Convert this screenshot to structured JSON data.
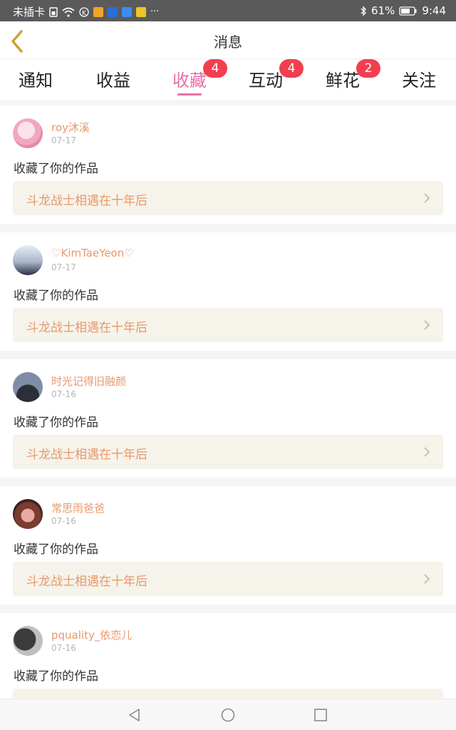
{
  "status": {
    "carrier": "未插卡",
    "more": "···",
    "battery": "61%",
    "time": "9:44"
  },
  "header": {
    "title": "消息",
    "back_icon": "chevron-left-icon"
  },
  "tabs": [
    {
      "label": "通知",
      "badge": ""
    },
    {
      "label": "收益",
      "badge": ""
    },
    {
      "label": "收藏",
      "badge": "4"
    },
    {
      "label": "互动",
      "badge": "4"
    },
    {
      "label": "鲜花",
      "badge": "2"
    },
    {
      "label": "关注",
      "badge": ""
    }
  ],
  "active_tab": "收藏",
  "colors": {
    "accent": "#e86fa8",
    "username": "#e8996a",
    "badge": "#f23f4f",
    "work_bg": "#f5f3ea"
  },
  "items": [
    {
      "user": "roy沐溪",
      "date": "07-17",
      "action": "收藏了你的作品",
      "work": "斗龙战士相遇在十年后"
    },
    {
      "user": "♡KimTaeYeon♡",
      "date": "07-17",
      "action": "收藏了你的作品",
      "work": "斗龙战士相遇在十年后"
    },
    {
      "user": "时光记得旧融颜",
      "date": "07-16",
      "action": "收藏了你的作品",
      "work": "斗龙战士相遇在十年后"
    },
    {
      "user": "常思雨爸爸",
      "date": "07-16",
      "action": "收藏了你的作品",
      "work": "斗龙战士相遇在十年后"
    },
    {
      "user": "pquality_依恋儿",
      "date": "07-16",
      "action": "收藏了你的作品",
      "work": ""
    }
  ]
}
